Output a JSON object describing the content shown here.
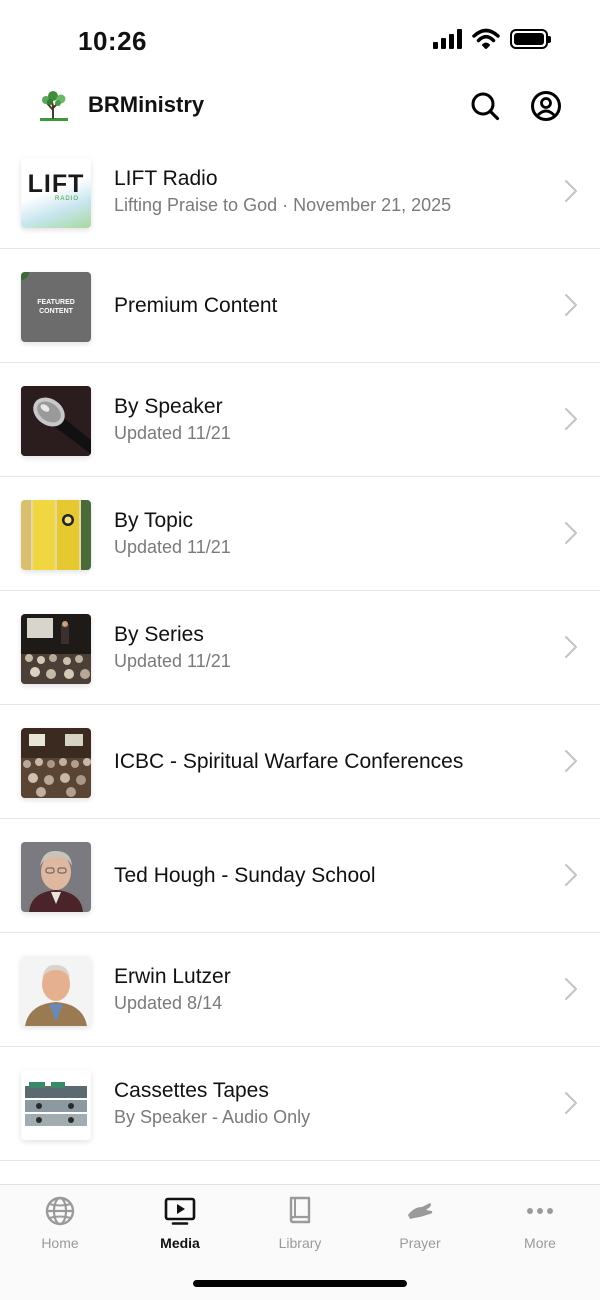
{
  "status_bar": {
    "time": "10:26"
  },
  "header": {
    "title": "BRMinistry"
  },
  "list": [
    {
      "title": "LIFT Radio",
      "subtitle": "Lifting Praise to God · November 21, 2025",
      "thumb_text": "LIFT",
      "thumb_subtext": "RADIO"
    },
    {
      "title": "Premium Content",
      "subtitle": "",
      "thumb_text": "FEATURED CONTENT"
    },
    {
      "title": "By Speaker",
      "subtitle": "Updated 11/21"
    },
    {
      "title": "By Topic",
      "subtitle": "Updated 11/21"
    },
    {
      "title": "By Series",
      "subtitle": "Updated 11/21"
    },
    {
      "title": "ICBC - Spiritual Warfare Conferences",
      "subtitle": ""
    },
    {
      "title": "Ted Hough - Sunday School",
      "subtitle": ""
    },
    {
      "title": "Erwin Lutzer",
      "subtitle": "Updated 8/14"
    },
    {
      "title": "Cassettes Tapes",
      "subtitle": "By Speaker - Audio Only"
    }
  ],
  "tabs": [
    {
      "label": "Home",
      "icon": "globe-icon"
    },
    {
      "label": "Media",
      "icon": "tv-play-icon",
      "active": true
    },
    {
      "label": "Library",
      "icon": "book-icon"
    },
    {
      "label": "Prayer",
      "icon": "praying-hands-icon"
    },
    {
      "label": "More",
      "icon": "ellipsis-icon"
    }
  ]
}
